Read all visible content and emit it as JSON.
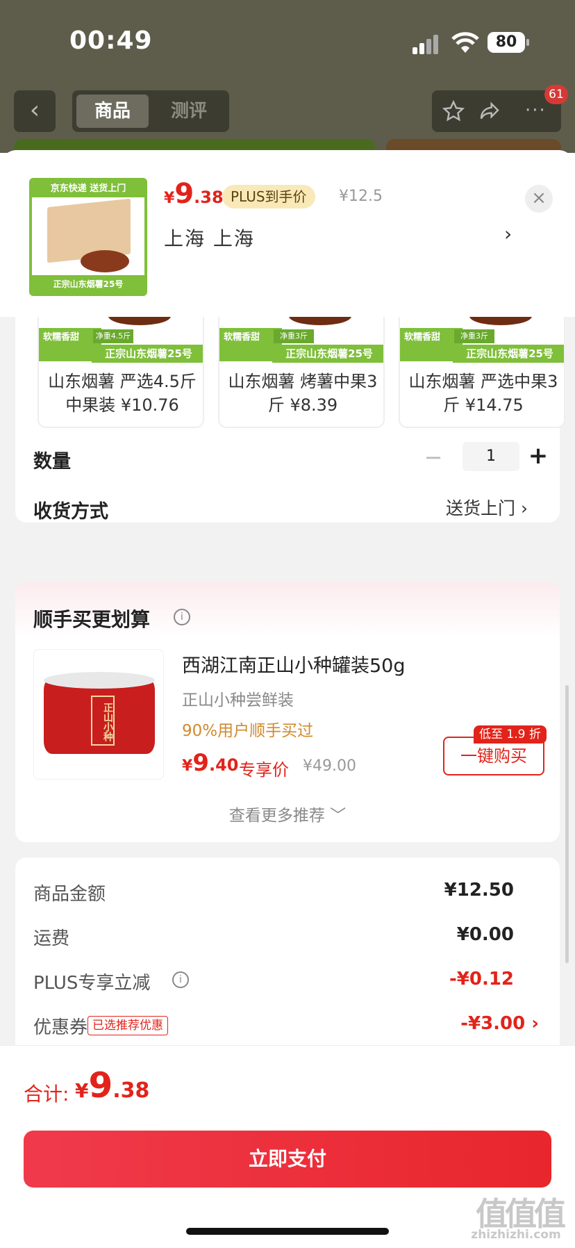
{
  "status_bar": {
    "time": "00:49",
    "battery": "80"
  },
  "top_nav": {
    "back_glyph": "‹",
    "tabs": [
      {
        "label": "商品",
        "active": true
      },
      {
        "label": "测评",
        "active": false
      }
    ],
    "more_glyph": "···",
    "badge_count": "61"
  },
  "header": {
    "price_symbol": "¥",
    "price_int": "9",
    "price_dec": ".38",
    "plus_label": "PLUS到手价",
    "original_price": "¥12.5",
    "close_glyph": "×",
    "address": "上海 上海",
    "address_arrow": "›",
    "image_strip_top": "京东快递 送货上门",
    "image_strip_bottom": "正宗山东烟薯25号"
  },
  "sku_options": [
    {
      "label": "山东烟薯 严选4.5斤中果装 ¥10.76",
      "tag1": "软糯香甜",
      "tag2": "净重4.5斤",
      "banner": "正宗山东烟薯25号"
    },
    {
      "label": "山东烟薯 烤薯中果3斤 ¥8.39",
      "tag1": "软糯香甜",
      "tag2": "净重3斤",
      "banner": "正宗山东烟薯25号"
    },
    {
      "label": "山东烟薯 严选中果3斤 ¥14.75",
      "tag1": "软糯香甜",
      "tag2": "净重3斤",
      "banner": "正宗山东烟薯25号"
    }
  ],
  "quantity": {
    "label": "数量",
    "value": "1",
    "minus": "−",
    "plus": "+"
  },
  "delivery": {
    "label": "收货方式",
    "value": "送货上门 ›"
  },
  "recommend": {
    "title": "顺手买更划算",
    "info_glyph": "i",
    "product_name": "西湖江南正山小种罐装50g",
    "product_sub": "正山小种尝鲜装",
    "buy_percent": "90%用户顺手买过",
    "price_symbol": "¥",
    "price_int": "9",
    "price_dec": ".40",
    "exclusive_label": "专享价",
    "original_price": "¥49.00",
    "discount_tag": "低至 1.9 折",
    "buy_button": "一键购买",
    "see_more": "查看更多推荐 ﹀",
    "tin_text": "正山小种"
  },
  "summary": {
    "rows": [
      {
        "label": "商品金额",
        "value": "¥12.50"
      },
      {
        "label": "运费",
        "value": "¥0.00"
      },
      {
        "label": "PLUS专享立减",
        "value": "-¥0.12"
      },
      {
        "label": "优惠券",
        "value": "-¥3.00 ›"
      }
    ],
    "coupon_tag": "已选推荐优惠"
  },
  "footer": {
    "total_label": "合计:",
    "total_symbol": "¥",
    "total_int": "9",
    "total_dec": ".38",
    "pay_button": "立即支付",
    "watermark": "值值值",
    "watermark_url": "zhizhizhi.com"
  },
  "colors": {
    "accent": "#e2231a",
    "plus_bg": "#f9e9b8",
    "product_green": "#7fbf3a"
  }
}
